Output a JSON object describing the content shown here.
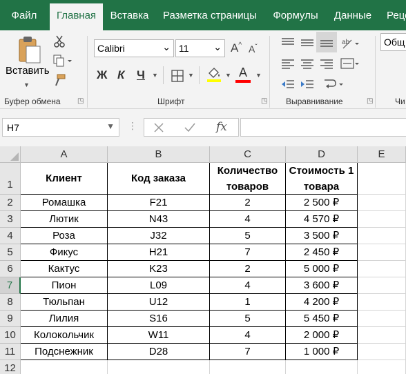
{
  "menu": {
    "tabs": [
      {
        "label": "Файл",
        "active": false
      },
      {
        "label": "Главная",
        "active": true
      },
      {
        "label": "Вставка",
        "active": false
      },
      {
        "label": "Разметка страницы",
        "active": false
      },
      {
        "label": "Формулы",
        "active": false
      },
      {
        "label": "Данные",
        "active": false
      },
      {
        "label": "Реце",
        "active": false
      }
    ]
  },
  "ribbon": {
    "clipboard": {
      "paste_label": "Вставить",
      "group_label": "Буфер обмена"
    },
    "font": {
      "family": "Calibri",
      "size": "11",
      "bold_label": "Ж",
      "italic_label": "К",
      "underline_label": "Ч",
      "font_color_glyph": "A",
      "grow_glyph": "A",
      "shrink_glyph": "A",
      "group_label": "Шрифт",
      "highlight_color": "#ffff00",
      "font_color": "#ff0000"
    },
    "alignment": {
      "group_label": "Выравнивание"
    },
    "number": {
      "format_value": "Общ",
      "group_label": "Чи"
    }
  },
  "formula_bar": {
    "name_box": "H7",
    "formula": "",
    "fx_label": "fx"
  },
  "sheet": {
    "columns": [
      "A",
      "B",
      "C",
      "D",
      "E"
    ],
    "rows": [
      "1",
      "2",
      "3",
      "4",
      "5",
      "6",
      "7",
      "8",
      "9",
      "10",
      "11",
      "12"
    ],
    "selected_row": "7",
    "headers": {
      "client": "Клиент",
      "order_code": "Код заказа",
      "qty_line1": "Количество",
      "qty_line2": "товаров",
      "cost_line1": "Стоимость 1",
      "cost_line2": "товара"
    },
    "data": [
      {
        "client": "Ромашка",
        "code": "F21",
        "qty": "2",
        "cost": "2 500 ₽"
      },
      {
        "client": "Лютик",
        "code": "N43",
        "qty": "4",
        "cost": "4 570 ₽"
      },
      {
        "client": "Роза",
        "code": "J32",
        "qty": "5",
        "cost": "3 500 ₽"
      },
      {
        "client": "Фикус",
        "code": "H21",
        "qty": "7",
        "cost": "2 450 ₽"
      },
      {
        "client": "Кактус",
        "code": "K23",
        "qty": "2",
        "cost": "5 000 ₽"
      },
      {
        "client": "Пион",
        "code": "L09",
        "qty": "4",
        "cost": "3 600 ₽"
      },
      {
        "client": "Тюльпан",
        "code": "U12",
        "qty": "1",
        "cost": "4 200 ₽"
      },
      {
        "client": "Лилия",
        "code": "S16",
        "qty": "5",
        "cost": "5 450 ₽"
      },
      {
        "client": "Колокольчик",
        "code": "W11",
        "qty": "4",
        "cost": "2 000 ₽"
      },
      {
        "client": "Подснежник",
        "code": "D28",
        "qty": "7",
        "cost": "1 000 ₽"
      }
    ]
  },
  "colors": {
    "accent": "#217346",
    "ribbon_bg": "#f3f3f3"
  }
}
